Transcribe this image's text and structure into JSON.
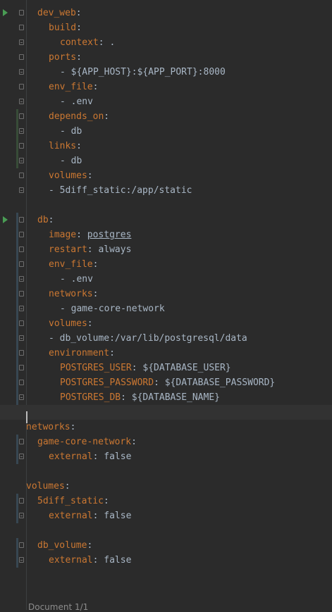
{
  "editor": {
    "lines": [
      {
        "key": "dev_web",
        "value": "",
        "indent": 1
      },
      {
        "key": "build",
        "value": "",
        "indent": 2
      },
      {
        "key": "context",
        "value": ".",
        "indent": 3
      },
      {
        "key": "ports",
        "value": "",
        "indent": 2
      },
      {
        "text": "- ${APP_HOST}:${APP_PORT}:8000",
        "indent": 3
      },
      {
        "key": "env_file",
        "value": "",
        "indent": 2
      },
      {
        "text": "- .env",
        "indent": 3
      },
      {
        "key": "depends_on",
        "value": "",
        "indent": 2
      },
      {
        "text": "- db",
        "indent": 3
      },
      {
        "key": "links",
        "value": "",
        "indent": 2
      },
      {
        "text": "- db",
        "indent": 3
      },
      {
        "key": "volumes",
        "value": "",
        "indent": 2
      },
      {
        "text": "- 5diff_static:/app/static",
        "indent": 2
      },
      {
        "text": "",
        "indent": 0
      },
      {
        "key": "db",
        "value": "",
        "indent": 1
      },
      {
        "key": "image",
        "value": "postgres",
        "indent": 2,
        "underline": true
      },
      {
        "key": "restart",
        "value": "always",
        "indent": 2
      },
      {
        "key": "env_file",
        "value": "",
        "indent": 2
      },
      {
        "text": "- .env",
        "indent": 3
      },
      {
        "key": "networks",
        "value": "",
        "indent": 2
      },
      {
        "text": "- game-core-network",
        "indent": 3
      },
      {
        "key": "volumes",
        "value": "",
        "indent": 2
      },
      {
        "text": "- db_volume:/var/lib/postgresql/data",
        "indent": 2
      },
      {
        "key": "environment",
        "value": "",
        "indent": 2
      },
      {
        "key": "POSTGRES_USER",
        "value": "${DATABASE_USER}",
        "indent": 3
      },
      {
        "key": "POSTGRES_PASSWORD",
        "value": "${DATABASE_PASSWORD}",
        "indent": 3
      },
      {
        "key": "POSTGRES_DB",
        "value": "${DATABASE_NAME}",
        "indent": 3
      },
      {
        "text": "",
        "indent": 0
      },
      {
        "key": "networks",
        "value": "",
        "indent": 0
      },
      {
        "key": "game-core-network",
        "value": "",
        "indent": 1
      },
      {
        "key": "external",
        "value": "false",
        "indent": 2
      },
      {
        "text": "",
        "indent": 0
      },
      {
        "key": "volumes",
        "value": "",
        "indent": 0
      },
      {
        "key": "5diff_static",
        "value": "",
        "indent": 1
      },
      {
        "key": "external",
        "value": "false",
        "indent": 2
      },
      {
        "text": "",
        "indent": 0
      },
      {
        "key": "db_volume",
        "value": "",
        "indent": 1
      },
      {
        "key": "external",
        "value": "false",
        "indent": 2
      }
    ]
  },
  "footer": {
    "status": "Document 1/1"
  },
  "colors": {
    "background": "#2b2b2b",
    "key": "#cc7832",
    "text": "#a9b7c6",
    "run_icon": "#499c54"
  }
}
